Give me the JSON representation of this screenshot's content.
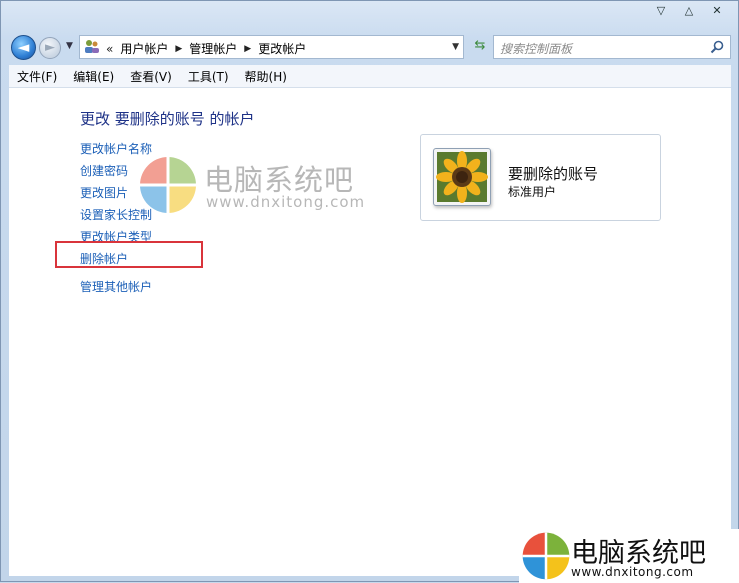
{
  "window": {
    "minimize": "▽",
    "maximize": "△",
    "close": "✕"
  },
  "address": {
    "overflow": "«",
    "crumbs": [
      "用户帐户",
      "管理帐户",
      "更改帐户"
    ]
  },
  "search": {
    "placeholder": "搜索控制面板"
  },
  "menu": [
    "文件(F)",
    "编辑(E)",
    "查看(V)",
    "工具(T)",
    "帮助(H)"
  ],
  "page": {
    "title": "更改 要删除的账号 的帐户",
    "tasks": [
      "更改帐户名称",
      "创建密码",
      "更改图片",
      "设置家长控制",
      "更改帐户类型",
      "删除帐户"
    ],
    "other": "管理其他帐户"
  },
  "account": {
    "name": "要删除的账号",
    "type": "标准用户"
  },
  "watermark": {
    "brand": "电脑系统吧",
    "url": "www.dnxitong.com"
  },
  "colors": {
    "link": "#1b5fb7",
    "title": "#1e3287",
    "highlight": "#d9343b"
  }
}
